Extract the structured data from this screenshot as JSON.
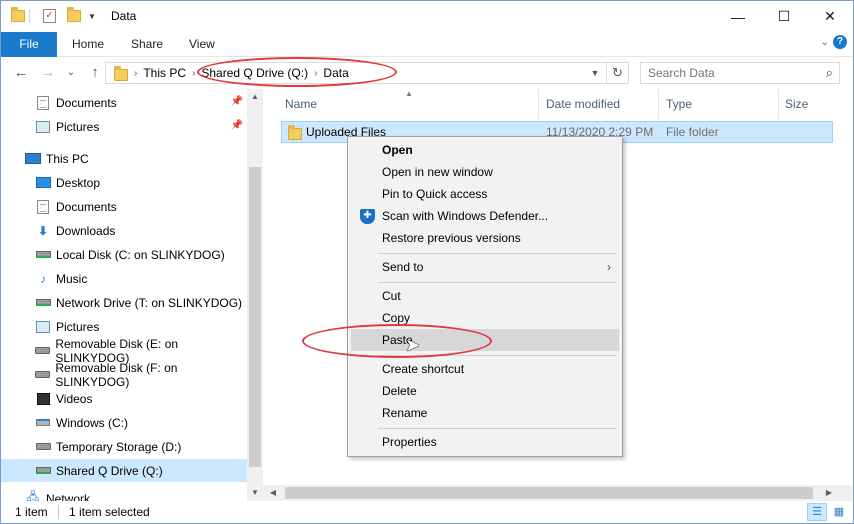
{
  "window": {
    "title": "Data",
    "minimize": "—",
    "maximize": "☐",
    "close": "✕"
  },
  "ribbon": {
    "file": "File",
    "home": "Home",
    "share": "Share",
    "view": "View",
    "expand": "⌄",
    "help": "?"
  },
  "nav": {
    "back": "←",
    "forward": "→",
    "recent": "⌄",
    "up": "↑",
    "breadcrumb": [
      "This PC",
      "Shared Q Drive (Q:)",
      "Data"
    ],
    "refresh": "↻"
  },
  "search": {
    "placeholder": "Search Data",
    "icon": "search-icon"
  },
  "sidebar": {
    "items": [
      {
        "label": "Documents",
        "icon": "documents-icon",
        "pinned": true
      },
      {
        "label": "Pictures",
        "icon": "pictures-icon",
        "pinned": true
      },
      {
        "label": "This PC",
        "icon": "computer-icon"
      },
      {
        "label": "Desktop",
        "icon": "desktop-icon"
      },
      {
        "label": "Documents",
        "icon": "documents-icon"
      },
      {
        "label": "Downloads",
        "icon": "downloads-icon"
      },
      {
        "label": "Local Disk (C: on SLINKYDOG)",
        "icon": "network-drive-icon"
      },
      {
        "label": "Music",
        "icon": "music-icon"
      },
      {
        "label": "Network Drive (T: on SLINKYDOG)",
        "icon": "network-drive-icon"
      },
      {
        "label": "Pictures",
        "icon": "pictures-icon"
      },
      {
        "label": "Removable Disk (E: on SLINKYDOG)",
        "icon": "removable-disk-icon"
      },
      {
        "label": "Removable Disk (F: on SLINKYDOG)",
        "icon": "removable-disk-icon"
      },
      {
        "label": "Videos",
        "icon": "videos-icon"
      },
      {
        "label": "Windows (C:)",
        "icon": "windows-drive-icon"
      },
      {
        "label": "Temporary Storage (D:)",
        "icon": "drive-icon"
      },
      {
        "label": "Shared Q Drive (Q:)",
        "icon": "network-drive-icon",
        "selected": true
      },
      {
        "label": "Network",
        "icon": "network-icon"
      }
    ]
  },
  "columns": {
    "name": "Name",
    "date_modified": "Date modified",
    "type": "Type",
    "size": "Size"
  },
  "files": [
    {
      "name": "Uploaded Files",
      "date_modified": "11/13/2020 2:29 PM",
      "type": "File folder",
      "size": ""
    }
  ],
  "context_menu": {
    "open": "Open",
    "open_new_window": "Open in new window",
    "pin_quick_access": "Pin to Quick access",
    "scan_defender": "Scan with Windows Defender...",
    "restore_versions": "Restore previous versions",
    "send_to": "Send to",
    "cut": "Cut",
    "copy": "Copy",
    "paste": "Paste",
    "create_shortcut": "Create shortcut",
    "delete": "Delete",
    "rename": "Rename",
    "properties": "Properties"
  },
  "status": {
    "item_count": "1 item",
    "selected": "1 item selected"
  },
  "colors": {
    "accent": "#1979ca",
    "selection": "#cce8ff",
    "annotation": "#e0383e"
  }
}
